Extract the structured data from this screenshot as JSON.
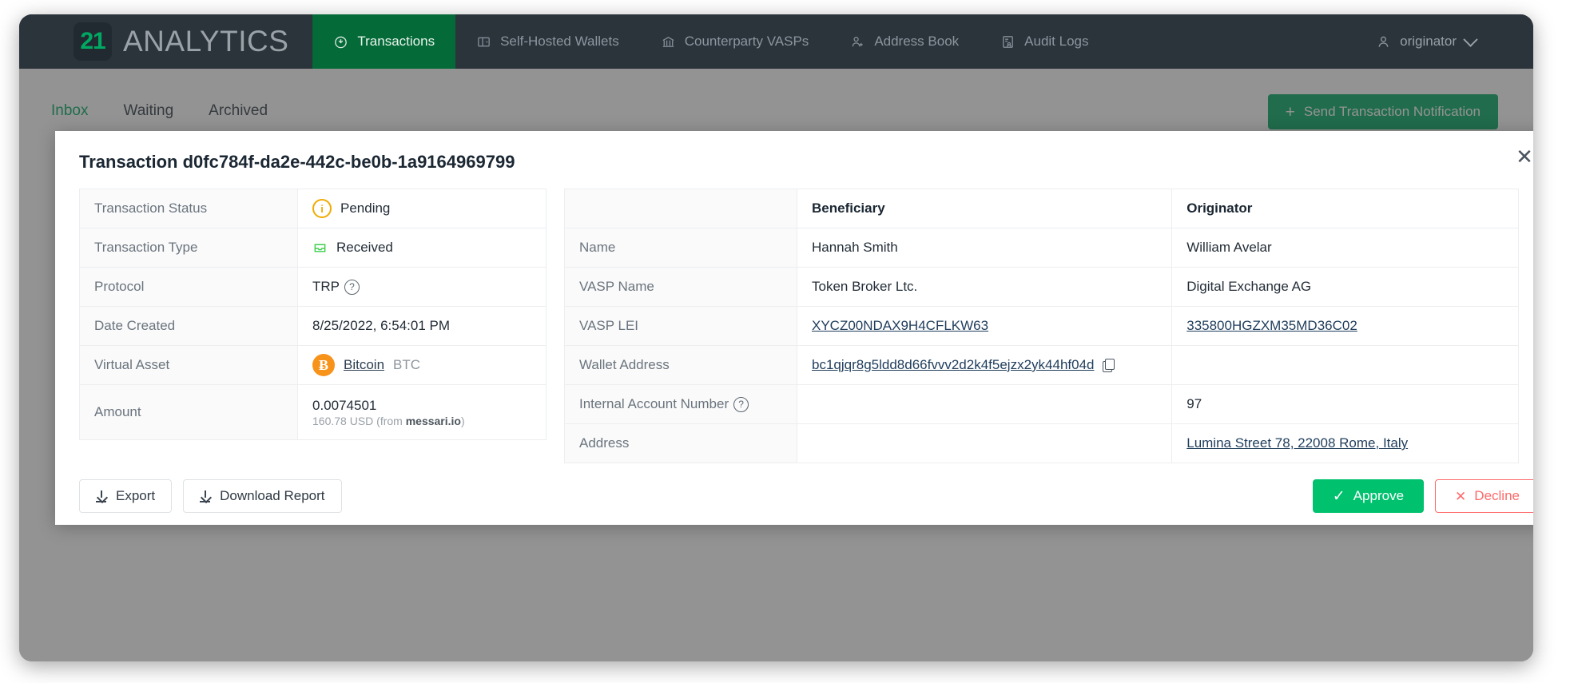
{
  "header": {
    "brand_badge": "21",
    "brand_word": "ANALYTICS",
    "nav": [
      {
        "label": "Transactions",
        "icon": "clock-arrow-icon",
        "active": true
      },
      {
        "label": "Self-Hosted Wallets",
        "icon": "wallet-icon",
        "active": false
      },
      {
        "label": "Counterparty VASPs",
        "icon": "bank-icon",
        "active": false
      },
      {
        "label": "Address Book",
        "icon": "user-add-icon",
        "active": false
      },
      {
        "label": "Audit Logs",
        "icon": "audit-log-icon",
        "active": false
      }
    ],
    "user": {
      "label": "originator",
      "icon": "user-icon",
      "chevron": "chevron-down-icon"
    }
  },
  "page": {
    "tabs": [
      {
        "label": "Inbox",
        "active": true
      },
      {
        "label": "Waiting",
        "active": false
      },
      {
        "label": "Archived",
        "active": false
      }
    ],
    "send_button": {
      "label": "Send Transaction Notification",
      "icon": "plus-icon",
      "plus": "+"
    }
  },
  "modal": {
    "title": "Transaction d0fc784f-da2e-442c-be0b-1a9164969799",
    "close_glyph": "✕",
    "left_table": {
      "rows": [
        {
          "key": "Transaction Status",
          "value": "Pending",
          "icon": "info-circle-icon",
          "icon_glyph": "i"
        },
        {
          "key": "Transaction Type",
          "value": "Received",
          "icon": "inbox-tray-icon"
        },
        {
          "key": "Protocol",
          "value": "TRP",
          "icon": "help-circle-icon",
          "help": "?"
        },
        {
          "key": "Date Created",
          "value": "8/25/2022, 6:54:01 PM"
        },
        {
          "key": "Virtual Asset",
          "value": "Bitcoin",
          "ticker": "BTC",
          "icon": "bitcoin-icon",
          "icon_glyph": "Ƀ"
        },
        {
          "key": "Amount",
          "value": "0.0074501",
          "sub_prefix": "160.78 USD (from ",
          "sub_source": "messari.io",
          "sub_suffix": ")"
        }
      ]
    },
    "right_table": {
      "headers": {
        "key": "",
        "beneficiary": "Beneficiary",
        "originator": "Originator"
      },
      "rows": [
        {
          "key": "Name",
          "beneficiary": "Hannah Smith",
          "originator": "William Avelar"
        },
        {
          "key": "VASP Name",
          "beneficiary": "Token Broker Ltc.",
          "originator": "Digital Exchange AG"
        },
        {
          "key": "VASP LEI",
          "beneficiary": "XYCZ00NDAX9H4CFLKW63",
          "originator": "335800HGZXM35MD36C02",
          "beneficiary_link": true,
          "originator_link": true
        },
        {
          "key": "Wallet Address",
          "beneficiary": "bc1qjqr8g5ldd8d66fvvv2d2k4f5ejzx2yk44hf04d",
          "originator": "",
          "beneficiary_link": true,
          "copy_icon": "copy-icon"
        },
        {
          "key": "Internal Account Number",
          "beneficiary": "",
          "originator": "97",
          "help": "?"
        },
        {
          "key": "Address",
          "beneficiary": "",
          "originator": "Lumina Street 78, 22008 Rome, Italy",
          "originator_link": true
        }
      ]
    },
    "footer": {
      "export": {
        "label": "Export",
        "icon": "download-icon"
      },
      "download_report": {
        "label": "Download Report",
        "icon": "download-icon"
      },
      "approve": {
        "label": "Approve",
        "icon": "check-icon",
        "glyph": "✓"
      },
      "decline": {
        "label": "Decline",
        "icon": "x-icon",
        "glyph": "✕"
      }
    }
  },
  "colors": {
    "brand_green": "#00a862",
    "nav_active": "#046a38",
    "header_bg": "#2b333b",
    "approve": "#00c26e",
    "decline": "#ff6b6b",
    "pending": "#f0ab00",
    "bitcoin": "#f7931a",
    "link": "#1f3d5c"
  }
}
